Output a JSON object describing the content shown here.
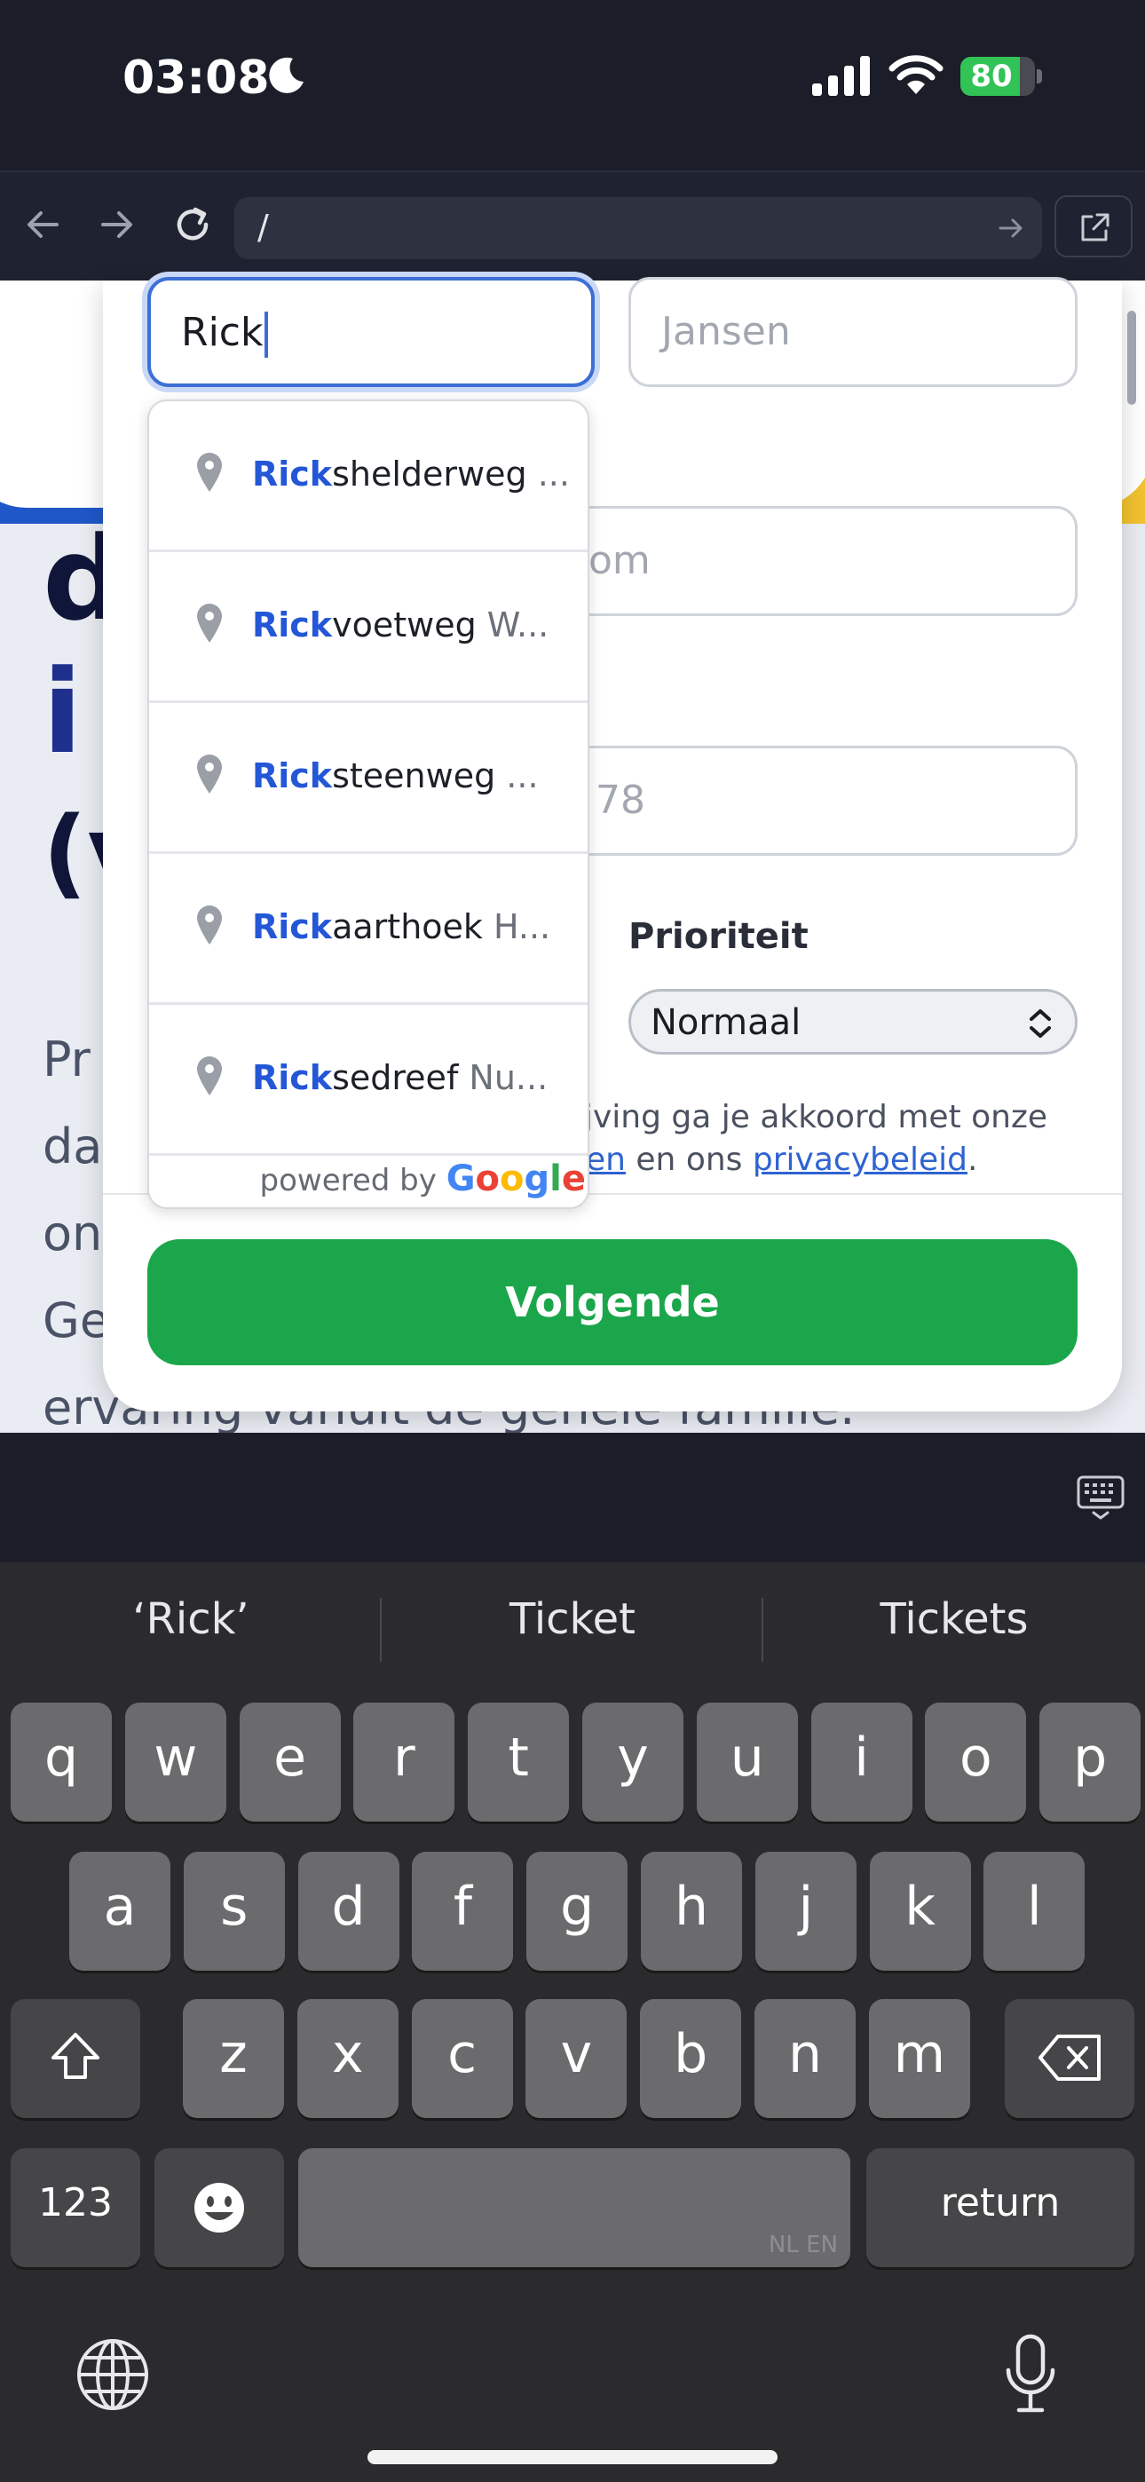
{
  "status_bar": {
    "time": "03:08",
    "battery": "80",
    "battery_level": 0.8
  },
  "browser": {
    "url": "/"
  },
  "background": {
    "heading_fragments": [
      "d",
      "i",
      "(v"
    ],
    "paragraph_fragments": [
      "Pr",
      "da",
      "on",
      "Ge"
    ],
    "last_line": "ervaring vanuit de gehele familie."
  },
  "form": {
    "first_name_value": "Rick",
    "last_name_placeholder": "Jansen",
    "email_placeholder_partial": "om",
    "phone_placeholder_partial": "78",
    "priority_label": "Prioriteit",
    "priority_value": "Normaal",
    "terms_line1": "jving ga je akkoord met onze",
    "terms_link1": "en",
    "terms_mid": " en ons ",
    "terms_link2": "privacybeleid",
    "terms_end": ".",
    "next_button": "Volgende"
  },
  "autocomplete": {
    "items": [
      {
        "match": "Rick",
        "rest": "shelderweg",
        "secondary": " ..."
      },
      {
        "match": "Rick",
        "rest": "voetweg",
        "secondary": " W..."
      },
      {
        "match": "Rick",
        "rest": "steenweg",
        "secondary": " ..."
      },
      {
        "match": "Rick",
        "rest": "aarthoek",
        "secondary": " H..."
      },
      {
        "match": "Rick",
        "rest": "sedreef",
        "secondary": " Nu..."
      }
    ],
    "powered_by": "powered by",
    "google": [
      "G",
      "o",
      "o",
      "g",
      "l",
      "e"
    ]
  },
  "keyboard": {
    "suggestions": [
      "‘Rick’",
      "Ticket",
      "Tickets"
    ],
    "row1": [
      "q",
      "w",
      "e",
      "r",
      "t",
      "y",
      "u",
      "i",
      "o",
      "p"
    ],
    "row2": [
      "a",
      "s",
      "d",
      "f",
      "g",
      "h",
      "j",
      "k",
      "l"
    ],
    "row3": [
      "z",
      "x",
      "c",
      "v",
      "b",
      "n",
      "m"
    ],
    "numbers_key": "123",
    "return_key": "return",
    "space_languages": "NL EN"
  },
  "colors": {
    "accent_blue": "#3c6fd6",
    "button_green": "#1ba64b",
    "battery_green": "#32c356",
    "brand_blue": "#1f57c8",
    "brand_yellow": "#f2c230"
  },
  "icons": [
    "moon-icon",
    "cellular-signal-icon",
    "wifi-icon",
    "back-arrow-icon",
    "forward-arrow-icon",
    "reload-icon",
    "go-arrow-icon",
    "open-external-icon",
    "location-pin-icon",
    "keyboard-hide-icon",
    "shift-icon",
    "backspace-icon",
    "emoji-icon",
    "globe-icon",
    "microphone-icon"
  ]
}
